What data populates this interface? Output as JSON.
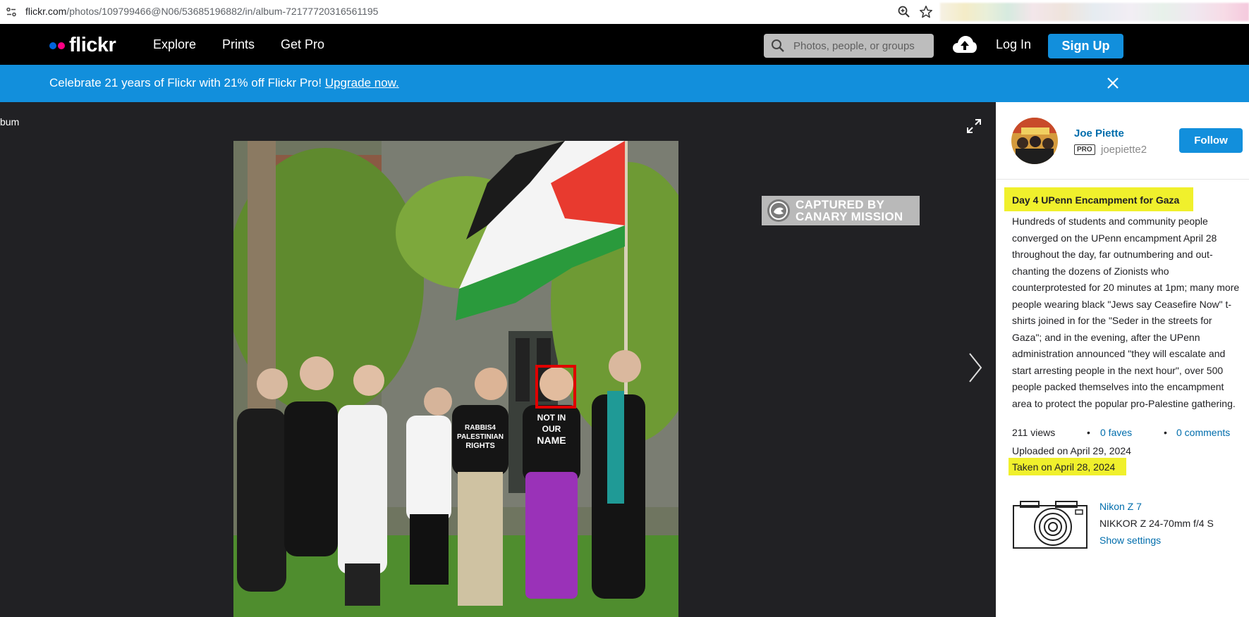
{
  "browser": {
    "url_host": "flickr.com",
    "url_path": "/photos/109799466@N06/53685196882/in/album-72177720316561195"
  },
  "nav": {
    "logo": "flickr",
    "links": [
      "Explore",
      "Prints",
      "Get Pro"
    ],
    "search_placeholder": "Photos, people, or groups",
    "login": "Log In",
    "signup": "Sign Up"
  },
  "promo": {
    "text": "Celebrate 21 years of Flickr with 21% off Flickr Pro! ",
    "link": "Upgrade now."
  },
  "stage": {
    "back_label": "bum",
    "watermark_line1": "CAPTURED BY",
    "watermark_line2": "CANARY MISSION",
    "shirt_text_1": "NOT IN",
    "shirt_text_2": "OUR",
    "shirt_text_3": "NAME",
    "shirt_text_4": "RABBIS4",
    "shirt_text_5": "PALESTINIAN",
    "shirt_text_6": "RIGHTS"
  },
  "sidebar": {
    "author_name": "Joe Piette",
    "pro_badge": "PRO",
    "username": "joepiette2",
    "follow": "Follow",
    "photo_title": "Day 4 UPenn Encampment for Gaza",
    "description": "Hundreds of students and community people converged on the UPenn encampment April 28 throughout the day, far outnumbering and out-chanting the dozens of Zionists who counterprotested for 20 minutes at 1pm; many more people wearing black \"Jews say Ceasefire Now\" t-shirts joined in for the \"Seder in the streets for Gaza\"; and in the evening, after the UPenn administration announced \"they will escalate and start arresting people in the next hour\", over 500 people packed themselves into the encampment area to protect the popular pro-Palestine gathering.",
    "views": "211 views",
    "faves": "0 faves",
    "comments": "0 comments",
    "bullet": "•",
    "uploaded": "Uploaded on April 29, 2024",
    "taken": "Taken on April 28, 2024",
    "camera": "Nikon Z 7",
    "lens": "NIKKOR Z 24-70mm f/4 S",
    "show_settings": "Show settings"
  },
  "colors": {
    "flickr_blue": "#128fdc",
    "link_blue": "#006dac",
    "highlight_yellow": "#f0f02c",
    "stage_bg": "#212124"
  }
}
